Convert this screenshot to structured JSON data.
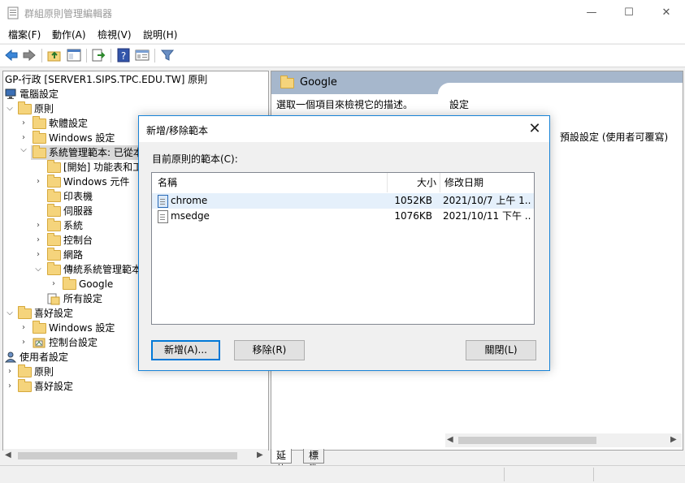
{
  "window": {
    "title": "群組原則管理編輯器",
    "minimize": "—",
    "maximize": "☐",
    "close": "✕"
  },
  "menu": [
    "檔案(F)",
    "動作(A)",
    "檢視(V)",
    "說明(H)"
  ],
  "tree": {
    "root": "GP-行政 [SERVER1.SIPS.TPC.EDU.TW] 原則",
    "items": [
      {
        "label": "電腦設定"
      },
      {
        "label": "原則"
      },
      {
        "label": "軟體設定"
      },
      {
        "label": "Windows 設定"
      },
      {
        "label": "系統管理範本: 已從本"
      },
      {
        "label": "[開始] 功能表和工"
      },
      {
        "label": "Windows 元件"
      },
      {
        "label": "印表機"
      },
      {
        "label": "伺服器"
      },
      {
        "label": "系統"
      },
      {
        "label": "控制台"
      },
      {
        "label": "網路"
      },
      {
        "label": "傳統系統管理範本"
      },
      {
        "label": "Google"
      },
      {
        "label": "所有設定"
      },
      {
        "label": "喜好設定"
      },
      {
        "label": "Windows 設定"
      },
      {
        "label": "控制台設定"
      },
      {
        "label": "使用者設定"
      },
      {
        "label": "原則"
      },
      {
        "label": "喜好設定"
      }
    ]
  },
  "right": {
    "header": "Google",
    "description": "選取一個項目來檢視它的描述。",
    "column_setting": "設定",
    "partial_text": "預設設定 (使用者可覆寫)"
  },
  "tabs": [
    "延伸",
    "標準"
  ],
  "dialog": {
    "title": "新增/移除範本",
    "label": "目前原則的範本(C):",
    "columns": [
      "名稱",
      "大小",
      "修改日期"
    ],
    "rows": [
      {
        "name": "chrome",
        "size": "1052KB",
        "date": "2021/10/7 上午 1..."
      },
      {
        "name": "msedge",
        "size": "1076KB",
        "date": "2021/10/11 下午 ..."
      }
    ],
    "buttons": {
      "add": "新增(A)...",
      "remove": "移除(R)",
      "close": "關閉(L)"
    }
  }
}
